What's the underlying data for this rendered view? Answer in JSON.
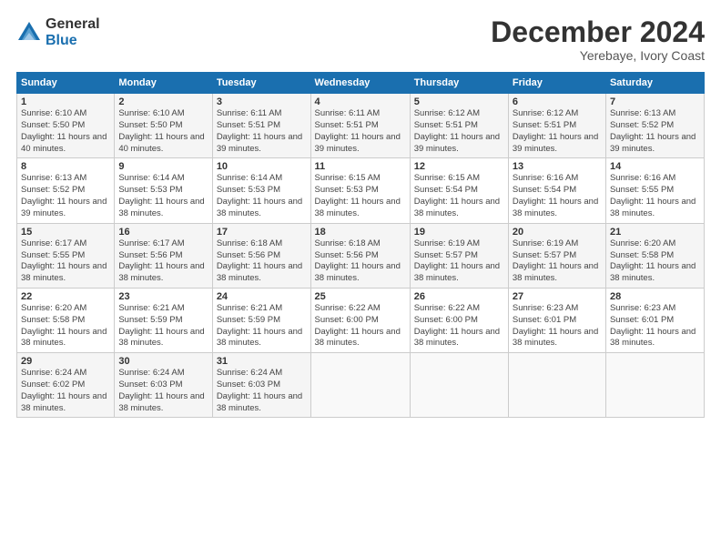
{
  "logo": {
    "general": "General",
    "blue": "Blue"
  },
  "title": "December 2024",
  "subtitle": "Yerebaye, Ivory Coast",
  "days_header": [
    "Sunday",
    "Monday",
    "Tuesday",
    "Wednesday",
    "Thursday",
    "Friday",
    "Saturday"
  ],
  "weeks": [
    [
      {
        "day": "1",
        "sunrise": "6:10 AM",
        "sunset": "5:50 PM",
        "daylight": "11 hours and 40 minutes."
      },
      {
        "day": "2",
        "sunrise": "6:10 AM",
        "sunset": "5:50 PM",
        "daylight": "11 hours and 40 minutes."
      },
      {
        "day": "3",
        "sunrise": "6:11 AM",
        "sunset": "5:51 PM",
        "daylight": "11 hours and 39 minutes."
      },
      {
        "day": "4",
        "sunrise": "6:11 AM",
        "sunset": "5:51 PM",
        "daylight": "11 hours and 39 minutes."
      },
      {
        "day": "5",
        "sunrise": "6:12 AM",
        "sunset": "5:51 PM",
        "daylight": "11 hours and 39 minutes."
      },
      {
        "day": "6",
        "sunrise": "6:12 AM",
        "sunset": "5:51 PM",
        "daylight": "11 hours and 39 minutes."
      },
      {
        "day": "7",
        "sunrise": "6:13 AM",
        "sunset": "5:52 PM",
        "daylight": "11 hours and 39 minutes."
      }
    ],
    [
      {
        "day": "8",
        "sunrise": "6:13 AM",
        "sunset": "5:52 PM",
        "daylight": "11 hours and 39 minutes."
      },
      {
        "day": "9",
        "sunrise": "6:14 AM",
        "sunset": "5:53 PM",
        "daylight": "11 hours and 38 minutes."
      },
      {
        "day": "10",
        "sunrise": "6:14 AM",
        "sunset": "5:53 PM",
        "daylight": "11 hours and 38 minutes."
      },
      {
        "day": "11",
        "sunrise": "6:15 AM",
        "sunset": "5:53 PM",
        "daylight": "11 hours and 38 minutes."
      },
      {
        "day": "12",
        "sunrise": "6:15 AM",
        "sunset": "5:54 PM",
        "daylight": "11 hours and 38 minutes."
      },
      {
        "day": "13",
        "sunrise": "6:16 AM",
        "sunset": "5:54 PM",
        "daylight": "11 hours and 38 minutes."
      },
      {
        "day": "14",
        "sunrise": "6:16 AM",
        "sunset": "5:55 PM",
        "daylight": "11 hours and 38 minutes."
      }
    ],
    [
      {
        "day": "15",
        "sunrise": "6:17 AM",
        "sunset": "5:55 PM",
        "daylight": "11 hours and 38 minutes."
      },
      {
        "day": "16",
        "sunrise": "6:17 AM",
        "sunset": "5:56 PM",
        "daylight": "11 hours and 38 minutes."
      },
      {
        "day": "17",
        "sunrise": "6:18 AM",
        "sunset": "5:56 PM",
        "daylight": "11 hours and 38 minutes."
      },
      {
        "day": "18",
        "sunrise": "6:18 AM",
        "sunset": "5:56 PM",
        "daylight": "11 hours and 38 minutes."
      },
      {
        "day": "19",
        "sunrise": "6:19 AM",
        "sunset": "5:57 PM",
        "daylight": "11 hours and 38 minutes."
      },
      {
        "day": "20",
        "sunrise": "6:19 AM",
        "sunset": "5:57 PM",
        "daylight": "11 hours and 38 minutes."
      },
      {
        "day": "21",
        "sunrise": "6:20 AM",
        "sunset": "5:58 PM",
        "daylight": "11 hours and 38 minutes."
      }
    ],
    [
      {
        "day": "22",
        "sunrise": "6:20 AM",
        "sunset": "5:58 PM",
        "daylight": "11 hours and 38 minutes."
      },
      {
        "day": "23",
        "sunrise": "6:21 AM",
        "sunset": "5:59 PM",
        "daylight": "11 hours and 38 minutes."
      },
      {
        "day": "24",
        "sunrise": "6:21 AM",
        "sunset": "5:59 PM",
        "daylight": "11 hours and 38 minutes."
      },
      {
        "day": "25",
        "sunrise": "6:22 AM",
        "sunset": "6:00 PM",
        "daylight": "11 hours and 38 minutes."
      },
      {
        "day": "26",
        "sunrise": "6:22 AM",
        "sunset": "6:00 PM",
        "daylight": "11 hours and 38 minutes."
      },
      {
        "day": "27",
        "sunrise": "6:23 AM",
        "sunset": "6:01 PM",
        "daylight": "11 hours and 38 minutes."
      },
      {
        "day": "28",
        "sunrise": "6:23 AM",
        "sunset": "6:01 PM",
        "daylight": "11 hours and 38 minutes."
      }
    ],
    [
      {
        "day": "29",
        "sunrise": "6:24 AM",
        "sunset": "6:02 PM",
        "daylight": "11 hours and 38 minutes."
      },
      {
        "day": "30",
        "sunrise": "6:24 AM",
        "sunset": "6:03 PM",
        "daylight": "11 hours and 38 minutes."
      },
      {
        "day": "31",
        "sunrise": "6:24 AM",
        "sunset": "6:03 PM",
        "daylight": "11 hours and 38 minutes."
      },
      null,
      null,
      null,
      null
    ]
  ],
  "labels": {
    "sunrise": "Sunrise:",
    "sunset": "Sunset:",
    "daylight": "Daylight:"
  }
}
